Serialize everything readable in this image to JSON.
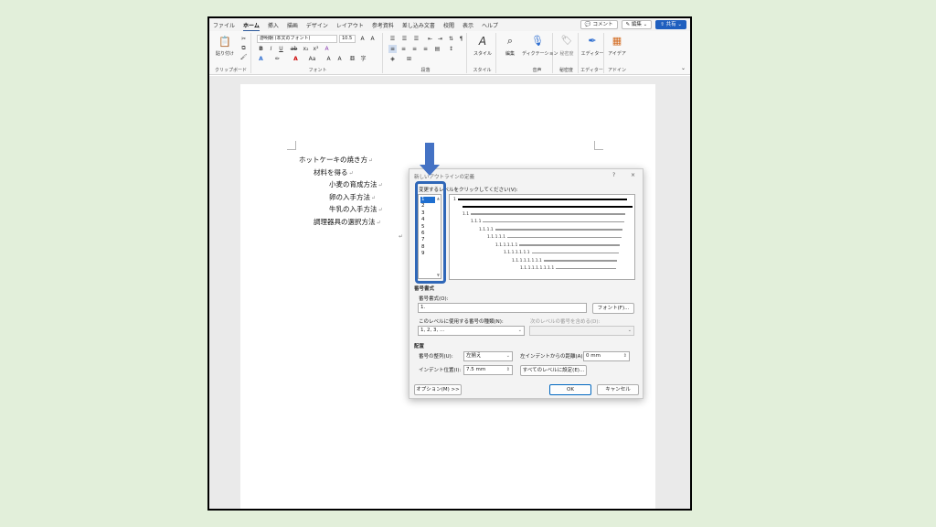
{
  "ribbon": {
    "tabs": [
      "ファイル",
      "ホーム",
      "挿入",
      "描画",
      "デザイン",
      "レイアウト",
      "参考資料",
      "差し込み文書",
      "校閲",
      "表示",
      "ヘルプ"
    ],
    "active_tab": "ホーム",
    "comment_label": "コメント",
    "edit_label": "編集",
    "share_label": "共有",
    "paste_label": "貼り付け",
    "font_name": "游明朝 (本文のフォント)",
    "font_size": "10.5",
    "style_label": "スタイル",
    "editing_label": "編集",
    "dictate_label": "ディクテーション",
    "sensitivity_label": "秘密度",
    "editor_label": "エディター",
    "designer_label": "アイデア",
    "groups": {
      "clipboard": "クリップボード",
      "font": "フォント",
      "paragraph": "段落",
      "style": "スタイル",
      "voice": "音声",
      "sensitivity": "秘密度",
      "editor": "エディター",
      "addin": "アドイン"
    }
  },
  "document": {
    "lines": [
      {
        "text": "ホットケーキの焼き方",
        "level": 1
      },
      {
        "text": "材料を得る",
        "level": 2
      },
      {
        "text": "小麦の育成方法",
        "level": 3
      },
      {
        "text": "卵の入手方法",
        "level": 3
      },
      {
        "text": "牛乳の入手方法",
        "level": 3
      },
      {
        "text": "調理器具の選択方法",
        "level": 2
      }
    ],
    "para_mark": "↵"
  },
  "dialog": {
    "title": "新しいアウトラインの定義",
    "help": "?",
    "close": "×",
    "level_prompt": "変更するレベルをクリックしてください(V):",
    "levels": [
      "1",
      "2",
      "3",
      "4",
      "5",
      "6",
      "7",
      "8",
      "9"
    ],
    "selected_level": "1",
    "preview_numbers": [
      "1",
      "1.1",
      "1.1.1",
      "1.1.1.1",
      "1.1.1.1.1",
      "1.1.1.1.1.1",
      "1.1.1.1.1.1.1",
      "1.1.1.1.1.1.1.1",
      "1.1.1.1.1.1.1.1.1"
    ],
    "number_format_section": "番号書式",
    "number_format_label": "番号書式(O):",
    "number_format_value": "1.",
    "font_button": "フォント(F)...",
    "number_style_label": "このレベルに使用する番号の種類(N):",
    "number_style_value": "1, 2, 3, ...",
    "include_level_label": "次のレベルの番号を含める(D):",
    "placement_section": "配置",
    "alignment_label": "番号の整列(U):",
    "alignment_value": "左揃え",
    "left_indent_label": "左インデントからの距離(A):",
    "left_indent_value": "0 mm",
    "indent_label": "インデント位置(I):",
    "indent_value": "7.5 mm",
    "set_all_button": "すべてのレベルに設定(E)...",
    "options_button": "オプション(M) >>",
    "ok_button": "OK",
    "cancel_button": "キャンセル"
  },
  "colors": {
    "accent": "#2b579a",
    "highlight": "#2f67b8",
    "arrow": "#4472c4",
    "background": "#e2efda"
  }
}
